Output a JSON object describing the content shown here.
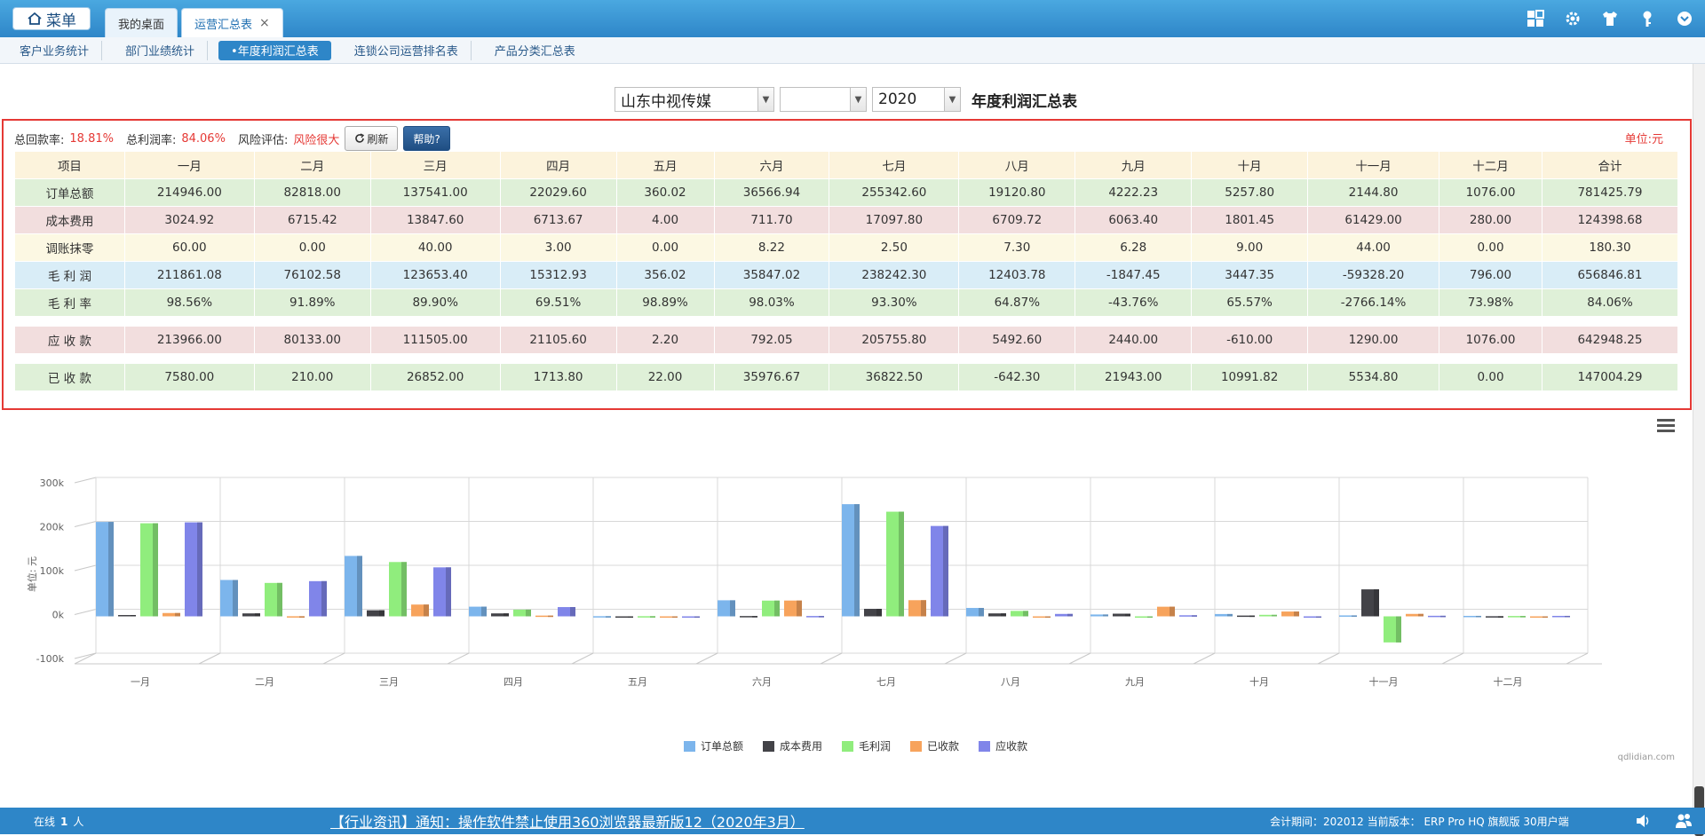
{
  "topbar": {
    "menu_label": "菜单",
    "tabs": [
      {
        "label": "我的桌面"
      },
      {
        "label": "运营汇总表",
        "close": "×"
      }
    ]
  },
  "subnav": {
    "items": [
      "客户业务统计",
      "部门业绩统计",
      "•年度利润汇总表",
      "连锁公司运营排名表",
      "产品分类汇总表"
    ]
  },
  "filters": {
    "company": "山东中视传媒",
    "second": "",
    "year": "2020",
    "title": "年度利润汇总表"
  },
  "stats": {
    "recovery_label": "总回款率:",
    "recovery_value": "18.81%",
    "profit_label": "总利润率:",
    "profit_value": "84.06%",
    "risk_label": "风险评估:",
    "risk_value": "风险很大",
    "refresh_label": "刷新",
    "help_label": "帮助?",
    "unit": "单位:元"
  },
  "table": {
    "headers": [
      "项目",
      "一月",
      "二月",
      "三月",
      "四月",
      "五月",
      "六月",
      "七月",
      "八月",
      "九月",
      "十月",
      "十一月",
      "十二月",
      "合计"
    ],
    "rows": [
      {
        "label": "订单总额",
        "style": "green",
        "values": [
          "214946.00",
          "82818.00",
          "137541.00",
          "22029.60",
          "360.02",
          "36566.94",
          "255342.60",
          "19120.80",
          "4222.23",
          "5257.80",
          "2144.80",
          "1076.00",
          "781425.79"
        ]
      },
      {
        "label": "成本费用",
        "style": "pink",
        "values": [
          "3024.92",
          "6715.42",
          "13847.60",
          "6713.67",
          "4.00",
          "711.70",
          "17097.80",
          "6709.72",
          "6063.40",
          "1801.45",
          "61429.00",
          "280.00",
          "124398.68"
        ]
      },
      {
        "label": "调账抹零",
        "style": "yellow",
        "values": [
          "60.00",
          "0.00",
          "40.00",
          "3.00",
          "0.00",
          "8.22",
          "2.50",
          "7.30",
          "6.28",
          "9.00",
          "44.00",
          "0.00",
          "180.30"
        ]
      },
      {
        "label": "毛 利 润",
        "style": "blue",
        "values": [
          "211861.08",
          "76102.58",
          "123653.40",
          "15312.93",
          "356.02",
          "35847.02",
          "238242.30",
          "12403.78",
          "-1847.45",
          "3447.35",
          "-59328.20",
          "796.00",
          "656846.81"
        ]
      },
      {
        "label": "毛 利 率",
        "style": "green",
        "values": [
          "98.56%",
          "91.89%",
          "89.90%",
          "69.51%",
          "98.89%",
          "98.03%",
          "93.30%",
          "64.87%",
          "-43.76%",
          "65.57%",
          "-2766.14%",
          "73.98%",
          "84.06%"
        ]
      },
      {
        "spacer": true
      },
      {
        "label": "应 收 款",
        "style": "pink",
        "values": [
          "213966.00",
          "80133.00",
          "111505.00",
          "21105.60",
          "2.20",
          "792.05",
          "205755.80",
          "5492.60",
          "2440.00",
          "-610.00",
          "1290.00",
          "1076.00",
          "642948.25"
        ]
      },
      {
        "spacer": true
      },
      {
        "label": "已 收 款",
        "style": "green",
        "values": [
          "7580.00",
          "210.00",
          "26852.00",
          "1713.80",
          "22.00",
          "35976.67",
          "36822.50",
          "-642.30",
          "21943.00",
          "10991.82",
          "5534.80",
          "0.00",
          "147004.29"
        ]
      }
    ]
  },
  "chart_data": {
    "type": "bar",
    "categories": [
      "一月",
      "二月",
      "三月",
      "四月",
      "五月",
      "六月",
      "七月",
      "八月",
      "九月",
      "十月",
      "十一月",
      "十二月"
    ],
    "ylabel": "单位: 元",
    "ylim": [
      -100000,
      300000
    ],
    "yticks": [
      "-100k",
      "0k",
      "100k",
      "200k",
      "300k"
    ],
    "yticks_values": [
      -100000,
      0,
      100000,
      200000,
      300000
    ],
    "series": [
      {
        "name": "订单总额",
        "color": "#7cb5ec",
        "values": [
          214946.0,
          82818.0,
          137541.0,
          22029.6,
          360.02,
          36566.94,
          255342.6,
          19120.8,
          4222.23,
          5257.8,
          2144.8,
          1076.0
        ]
      },
      {
        "name": "成本费用",
        "color": "#434348",
        "values": [
          3024.92,
          6715.42,
          13847.6,
          6713.67,
          4.0,
          711.7,
          17097.8,
          6709.72,
          6063.4,
          1801.45,
          61429.0,
          280.0
        ]
      },
      {
        "name": "毛利润",
        "color": "#90ed7d",
        "values": [
          211861.08,
          76102.58,
          123653.4,
          15312.93,
          356.02,
          35847.02,
          238242.3,
          12403.78,
          -1847.45,
          3447.35,
          -59328.2,
          796.0
        ]
      },
      {
        "name": "已收款",
        "color": "#f7a35c",
        "values": [
          7580.0,
          210.0,
          26852.0,
          1713.8,
          22.0,
          35976.67,
          36822.5,
          -642.3,
          21943.0,
          10991.82,
          5534.8,
          0.0
        ]
      },
      {
        "name": "应收款",
        "color": "#8085e9",
        "values": [
          213966.0,
          80133.0,
          111505.0,
          21105.6,
          2.2,
          792.05,
          205755.8,
          5492.6,
          2440.0,
          -610.0,
          1290.0,
          1076.0
        ]
      }
    ],
    "legend_position": "bottom-center",
    "grid": true,
    "credit": "qdlidian.com"
  },
  "footer": {
    "online_label": "在线",
    "online_count": "1",
    "online_unit": "人",
    "news": "【行业资讯】通知：操作软件禁止使用360浏览器最新版12（2020年3月）",
    "meta": "会计期间：202012 当前版本： ERP Pro HQ 旗舰版 30用户端"
  },
  "icons": [
    "home-icon",
    "grid-add-icon",
    "gear-icon",
    "shirt-icon",
    "key-icon",
    "chevron-down-icon",
    "refresh-icon",
    "speaker-icon",
    "users-icon"
  ]
}
